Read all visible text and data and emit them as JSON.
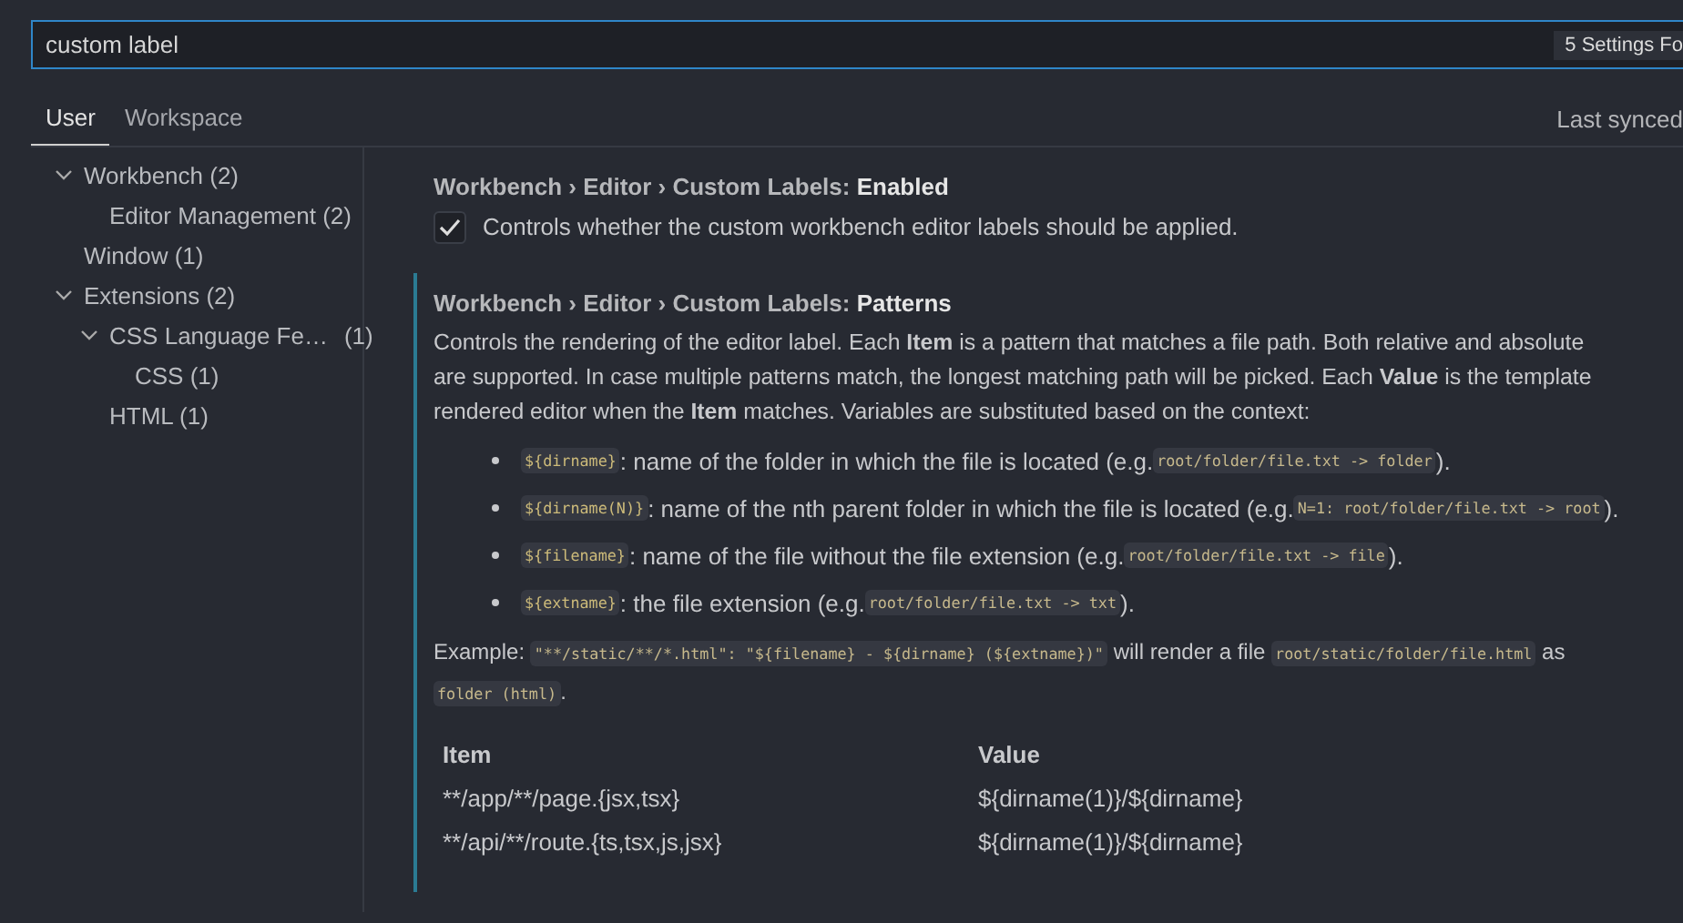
{
  "search": {
    "value": "custom label",
    "badge": "5 Settings Fo"
  },
  "tabs": [
    {
      "label": "User",
      "selected": true
    },
    {
      "label": "Workspace",
      "selected": false
    }
  ],
  "sync_status": "Last synced",
  "tree": [
    {
      "label": "Workbench (2)",
      "expanded": true,
      "children": [
        {
          "label": "Editor Management (2)"
        }
      ]
    },
    {
      "label": "Window (1)"
    },
    {
      "label": "Extensions (2)",
      "expanded": true,
      "children": [
        {
          "label": "CSS Language Fe…",
          "count": "(1)",
          "expanded": true,
          "children": [
            {
              "label": "CSS (1)"
            }
          ]
        },
        {
          "label": "HTML (1)"
        }
      ]
    }
  ],
  "settings": [
    {
      "kind": "checkbox",
      "focused": false,
      "title": "Workbench › Editor › Custom Labels: **Enabled**",
      "checked": true,
      "description": "Controls whether the custom workbench editor labels should be applied."
    },
    {
      "kind": "table",
      "focused": true,
      "title": "Workbench › Editor › Custom Labels: **Patterns**",
      "description_lines": [
        "Controls the rendering of the editor label. Each **Item** is a pattern that matches a file path. Both relative and absolute",
        "are supported. In case multiple patterns match, the longest matching path will be picked. Each **Value** is the template",
        "rendered editor when the **Item** matches. Variables are substituted based on the context:"
      ],
      "bullets": [
        [
          {
            "kind": "code",
            "text": "${dirname}"
          },
          {
            "kind": "text",
            "text": ": name of the folder in which the file is located (e.g. "
          },
          {
            "kind": "code",
            "text": "root/folder/file.txt -> folder"
          },
          {
            "kind": "text",
            "text": ")."
          }
        ],
        [
          {
            "kind": "code",
            "text": "${dirname(N)}"
          },
          {
            "kind": "text",
            "text": ": name of the nth parent folder in which the file is located (e.g. "
          },
          {
            "kind": "code",
            "text": "N=1: root/folder/file.txt -> root"
          },
          {
            "kind": "text",
            "text": ")."
          }
        ],
        [
          {
            "kind": "code",
            "text": "${filename}"
          },
          {
            "kind": "text",
            "text": ": name of the file without the file extension (e.g. "
          },
          {
            "kind": "code",
            "text": "root/folder/file.txt -> file"
          },
          {
            "kind": "text",
            "text": ")."
          }
        ],
        [
          {
            "kind": "code",
            "text": "${extname}"
          },
          {
            "kind": "text",
            "text": ": the file extension (e.g. "
          },
          {
            "kind": "code",
            "text": "root/folder/file.txt -> txt"
          },
          {
            "kind": "text",
            "text": ")."
          }
        ]
      ],
      "example_lines": [
        [
          {
            "kind": "text",
            "text": "Example: "
          },
          {
            "kind": "code",
            "text": "\"**/static/**/*.html\": \"${filename} - ${dirname} (${extname})\""
          },
          {
            "kind": "text",
            "text": " will render a file "
          },
          {
            "kind": "code",
            "text": "root/static/folder/file.html"
          },
          {
            "kind": "text",
            "text": " as"
          }
        ],
        [
          {
            "kind": "code",
            "text": "folder (html)"
          },
          {
            "kind": "text",
            "text": "."
          }
        ]
      ],
      "columns": [
        "Item",
        "Value"
      ],
      "rows": [
        [
          "**/app/**/page.{jsx,tsx}",
          "${dirname(1)}/${dirname}"
        ],
        [
          "**/api/**/route.{ts,tsx,js,jsx}",
          "${dirname(1)}/${dirname}"
        ]
      ]
    }
  ]
}
